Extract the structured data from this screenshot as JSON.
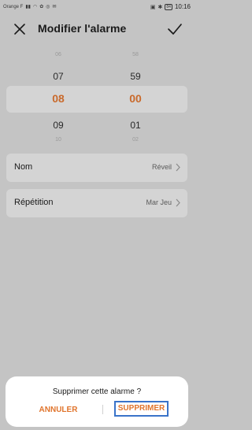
{
  "status_bar": {
    "carrier": "Orange F",
    "battery": "84",
    "time": "10:16"
  },
  "header": {
    "title": "Modifier l'alarme"
  },
  "picker": {
    "hours": [
      "06",
      "07",
      "08",
      "09",
      "10"
    ],
    "minutes": [
      "58",
      "59",
      "00",
      "01",
      "02"
    ]
  },
  "settings": {
    "name_label": "Nom",
    "name_value": "Réveil",
    "repeat_label": "Répétition",
    "repeat_value": "Mar Jeu"
  },
  "dialog": {
    "message": "Supprimer cette alarme ?",
    "cancel_label": "ANNULER",
    "delete_label": "SUPPRIMER"
  },
  "colors": {
    "accent": "#e0742c",
    "selected_time": "#c96a2c",
    "highlight_border": "#3a73c9"
  }
}
